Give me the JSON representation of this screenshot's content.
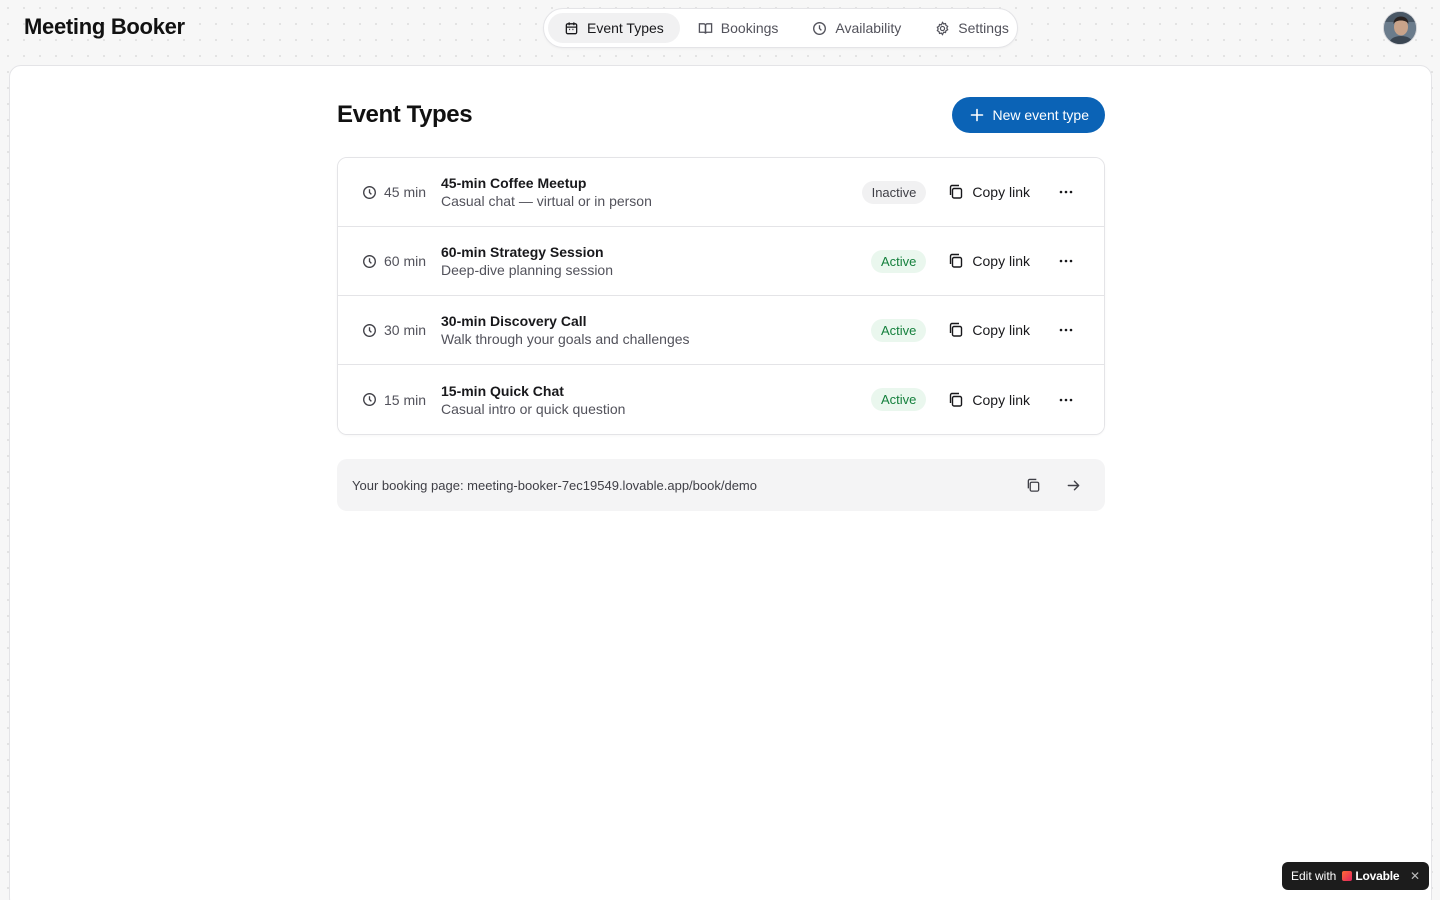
{
  "app": {
    "title": "Meeting Booker"
  },
  "nav": {
    "tabs": [
      {
        "label": "Event Types",
        "icon": "calendar-icon",
        "active": true
      },
      {
        "label": "Bookings",
        "icon": "book-icon",
        "active": false
      },
      {
        "label": "Availability",
        "icon": "clock-icon",
        "active": false
      },
      {
        "label": "Settings",
        "icon": "gear-icon",
        "active": false
      }
    ]
  },
  "main": {
    "title": "Event Types",
    "new_button": "New event type",
    "events": [
      {
        "duration": "45 min",
        "name": "45-min Coffee Meetup",
        "description": "Casual chat — virtual or in person",
        "status": "Inactive",
        "copy_label": "Copy link"
      },
      {
        "duration": "60 min",
        "name": "60-min Strategy Session",
        "description": "Deep-dive planning session",
        "status": "Active",
        "copy_label": "Copy link"
      },
      {
        "duration": "30 min",
        "name": "30-min Discovery Call",
        "description": "Walk through your goals and challenges",
        "status": "Active",
        "copy_label": "Copy link"
      },
      {
        "duration": "15 min",
        "name": "15-min Quick Chat",
        "description": "Casual intro or quick question",
        "status": "Active",
        "copy_label": "Copy link"
      }
    ],
    "booking_page": "Your booking page: meeting-booker-7ec19549.lovable.app/book/demo"
  },
  "badge": {
    "edit_with": "Edit with",
    "brand": "Lovable"
  },
  "colors": {
    "accent": "#0b63b6",
    "active_bg": "#eaf7ee",
    "active_text": "#15803d",
    "inactive_bg": "#f1f1f2"
  }
}
